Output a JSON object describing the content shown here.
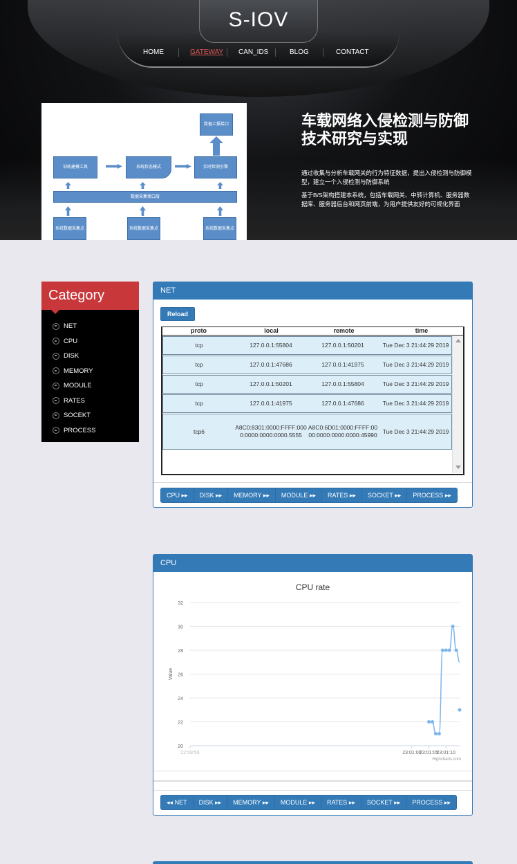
{
  "site": {
    "title": "S-IOV",
    "nav": [
      {
        "label": "HOME",
        "active": false
      },
      {
        "label": "GATEWAY",
        "active": true
      },
      {
        "label": "CAN_IDS",
        "active": false
      },
      {
        "label": "BLOG",
        "active": false
      },
      {
        "label": "CONTACT",
        "active": false
      }
    ]
  },
  "diagram": {
    "upload": "数据上报接口",
    "train": "训练建模工具",
    "state": "系统状态模式",
    "engine": "实时检测引擎",
    "collect": "数据采集接口层",
    "node1": "系统数据采集点",
    "node2": "系统数据采集点",
    "node3": "系统数据采集点"
  },
  "hero": {
    "title": "车载网络入侵检测与防御技术研究与实现",
    "desc1": "通过收集与分析车载网关的行为特征数据，提出入侵检测与防御模型，建立一个入侵检测与防御系统",
    "desc2": "基于B/S架构搭建本系统，包括车载网关、中转计算机、服务器数据库、服务器后台和网页前端，为用户提供友好的可视化界面"
  },
  "category": {
    "title": "Category",
    "items": [
      "NET",
      "CPU",
      "DISK",
      "MEMORY",
      "MODULE",
      "RATES",
      "SOCEKT",
      "PROCESS"
    ]
  },
  "net_panel": {
    "title": "NET",
    "reload": "Reload",
    "columns": [
      "proto",
      "local",
      "remote",
      "time"
    ],
    "rows": [
      {
        "proto": "tcp",
        "local": "127.0.0.1:55804",
        "remote": "127.0.0.1:50201",
        "time": "Tue Dec 3 21:44:29 2019"
      },
      {
        "proto": "tcp",
        "local": "127.0.0.1:47686",
        "remote": "127.0.0.1:41975",
        "time": "Tue Dec 3 21:44:29 2019"
      },
      {
        "proto": "tcp",
        "local": "127.0.0.1:50201",
        "remote": "127.0.0.1:55804",
        "time": "Tue Dec 3 21:44:29 2019"
      },
      {
        "proto": "tcp",
        "local": "127.0.0.1:41975",
        "remote": "127.0.0.1:47686",
        "time": "Tue Dec 3 21:44:29 2019"
      },
      {
        "proto": "tcp6",
        "local": "A8C0:8301:0000:FFFF:0000:0000:0000:0000.5555",
        "remote": "A8C0:6D01:0000:FFFF:00 00:0000:0000:0000:45990",
        "time": "Tue Dec 3 21:44:29 2019"
      }
    ],
    "nav": [
      "CPU",
      "DISK",
      "MEMORY",
      "MODULE",
      "RATES",
      "SOCKET",
      "PROCESS"
    ]
  },
  "cpu_panel": {
    "title": "CPU",
    "nav": [
      "NET",
      "DISK",
      "MEMORY",
      "MODULE",
      "RATES",
      "SOCKET",
      "PROCESS"
    ],
    "credit": "Highcharts.com"
  },
  "chart_data": {
    "type": "line",
    "title": "CPU rate",
    "ylabel": "Value",
    "xlabel": "",
    "ylim": [
      20,
      32
    ],
    "yticks": [
      20,
      22,
      24,
      26,
      28,
      30,
      32
    ],
    "xlim": [
      "22:59:55",
      "23:01:14"
    ],
    "xticks": [
      "22:59:55",
      "23:01:00",
      "23:01:05",
      "23:01:10"
    ],
    "grid": true,
    "color": "#7cb5ec",
    "x": [
      "23:01:05",
      "23:01:06",
      "23:01:07",
      "23:01:08",
      "23:01:09",
      "23:01:10",
      "23:01:11",
      "23:01:12",
      "23:01:13",
      "23:01:14"
    ],
    "values": [
      22,
      22,
      21,
      21,
      28,
      28,
      28,
      30,
      28,
      27
    ],
    "extra_points": [
      {
        "x": "23:01:14",
        "y": 23
      }
    ]
  },
  "colors": {
    "accent": "#337ab7",
    "category_head": "#c8373a",
    "row_bg": "#dceef8"
  }
}
